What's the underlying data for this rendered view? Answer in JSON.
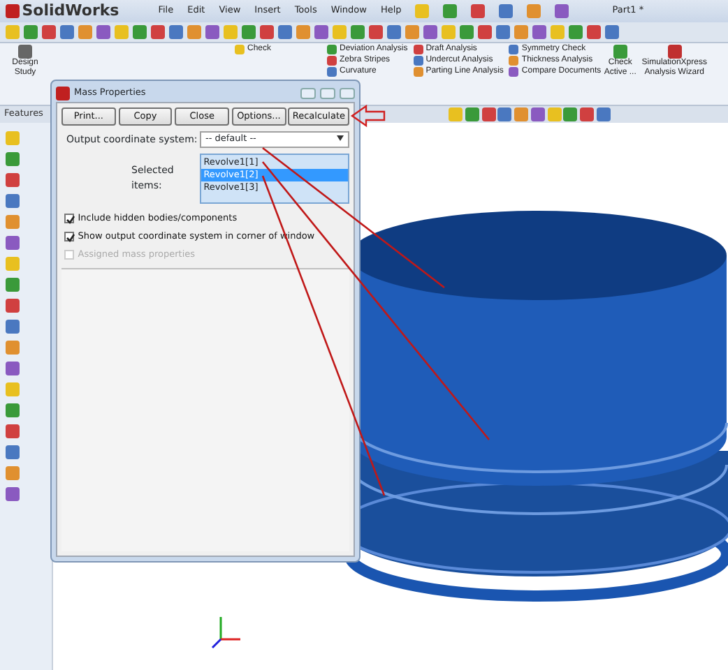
{
  "app": {
    "logo": "SolidWorks",
    "menu": [
      "File",
      "Edit",
      "View",
      "Insert",
      "Tools",
      "Window",
      "Help"
    ],
    "document_title": "Part1 *"
  },
  "ribbon": {
    "design_study": "Design Study",
    "columns": [
      {
        "items": [
          "Check"
        ]
      },
      {
        "items": [
          "Deviation Analysis",
          "Zebra Stripes",
          "Curvature"
        ]
      },
      {
        "items": [
          "Draft Analysis",
          "Undercut Analysis",
          "Parting Line Analysis"
        ]
      },
      {
        "items": [
          "Symmetry Check",
          "Thickness Analysis",
          "Compare Documents"
        ]
      }
    ],
    "check_active": "Check Active ...",
    "simulation": "SimulationXpress Analysis Wizard"
  },
  "panel_tab": "Features",
  "dialog": {
    "title": "Mass Properties",
    "buttons": [
      "Print...",
      "Copy",
      "Close",
      "Options...",
      "Recalculate"
    ],
    "coordinate_label": "Output coordinate system:",
    "coordinate_value": "-- default --",
    "selected_label": "Selected items:",
    "selected_items": [
      {
        "label": "Revolve1[1]",
        "selected": false
      },
      {
        "label": "Revolve1[2]",
        "selected": true
      },
      {
        "label": "Revolve1[3]",
        "selected": false
      }
    ],
    "options": [
      {
        "label": "Include hidden bodies/components",
        "checked": true,
        "disabled": false
      },
      {
        "label": "Show output coordinate system in corner of window",
        "checked": true,
        "disabled": false
      },
      {
        "label": "Assigned mass properties",
        "checked": false,
        "disabled": true
      }
    ]
  }
}
